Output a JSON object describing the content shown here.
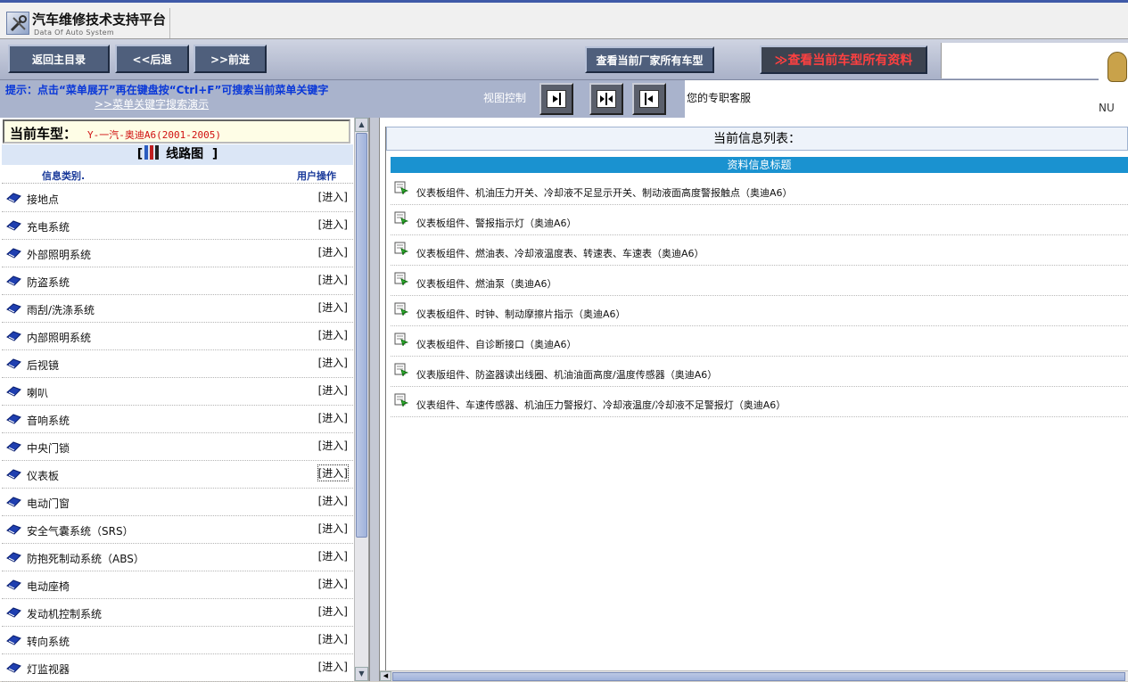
{
  "app": {
    "title": "汽车维修技术支持平台",
    "subtitle": "Data Of Auto System"
  },
  "toolbar": {
    "home_label": "返回主目录",
    "back_label": "<<后退",
    "forward_label": ">>前进",
    "maker_models_label": "查看当前厂家所有车型",
    "all_data_label": "≫查看当前车型所有资料",
    "mascot_tag": "NU"
  },
  "hint": {
    "text": "提示：点击“菜单展开”再在键盘按“Ctrl+F”可搜索当前菜单关键字",
    "link": ">>菜单关键字搜索演示"
  },
  "view_control": {
    "label": "视图控制"
  },
  "service": {
    "text": "您的专职客服"
  },
  "left": {
    "model_label": "当前车型：",
    "model_value": "Y-一汽-奥迪A6(2001-2005)",
    "category_title": "线路图",
    "bracket_open": "[",
    "bracket_close": "]",
    "col_type": "信息类别.",
    "col_action": "用户操作",
    "enter_label": "[进入]",
    "categories": [
      "接地点",
      "充电系统",
      "外部照明系统",
      "防盗系统",
      "雨刮/洗涤系统",
      "内部照明系统",
      "后视镜",
      "喇叭",
      "音响系统",
      "中央门锁",
      "仪表板",
      "电动门窗",
      "安全气囊系统（SRS）",
      "防抱死制动系统（ABS）",
      "电动座椅",
      "发动机控制系统",
      "转向系统",
      "灯监视器"
    ]
  },
  "right": {
    "header": "当前信息列表：",
    "list_header": "资料信息标题",
    "items": [
      "仪表板组件、机油压力开关、冷却液不足显示开关、制动液面高度警报触点（奥迪A6）",
      "仪表板组件、警报指示灯（奥迪A6）",
      "仪表板组件、燃油表、冷却液温度表、转速表、车速表（奥迪A6）",
      "仪表板组件、燃油泵（奥迪A6）",
      "仪表板组件、时钟、制动摩擦片指示（奥迪A6）",
      "仪表板组件、自诊断接口（奥迪A6）",
      "仪表版组件、防盗器读出线圈、机油油面高度/温度传感器（奥迪A6）",
      "仪表组件、车速传感器、机油压力警报灯、冷却液温度/冷却液不足警报灯（奥迪A6）"
    ]
  },
  "colors": {
    "hint_blue": "#0a38d8",
    "model_red": "#d01010",
    "list_header_blue": "#1a92d0",
    "button_dark": "#4f5f7c"
  }
}
